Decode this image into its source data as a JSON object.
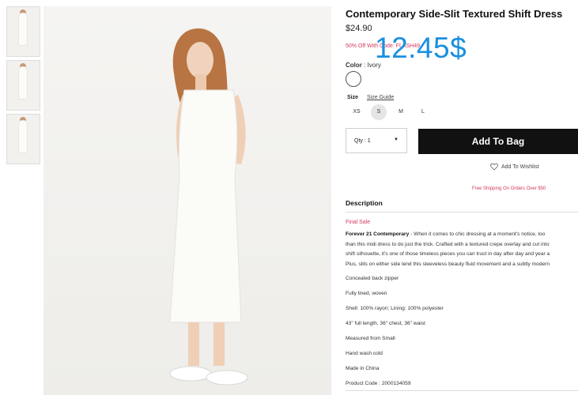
{
  "thumbnails": [
    {
      "alt": ""
    },
    {
      "alt": ""
    },
    {
      "alt": ""
    }
  ],
  "product": {
    "title": "Contemporary Side-Slit Textured Shift Dress",
    "price": "$24.90",
    "promo": "50% Off With Code: FLASH49",
    "overlay_price": "12.45$",
    "color_label": "Color",
    "color_value": ": Ivory",
    "swatch_color": "#ffffff",
    "size_label": "Size",
    "size_guide": "Size Guide",
    "sizes": [
      "XS",
      "S",
      "M",
      "L"
    ],
    "selected_size": "S",
    "qty_value": "Qty : 1",
    "add_to_bag": "Add To Bag",
    "wishlist": "Add To Wishlist",
    "shipping": "Free Shipping On Orders Over $50"
  },
  "description": {
    "heading": "Description",
    "final_sale": "Final Sale",
    "brand": "Forever 21 Contemporary",
    "lines": [
      " - When it comes to chic dressing at a moment's notice, loo",
      "than this midi dress to do just the trick. Crafted with a textured crepe overlay and cut into",
      "shift silhouette, it's one of those timeless pieces you can trust in day after day and year a",
      "Plus, slits on either side lend this sleeveless beauty fluid movement and a subtly modern"
    ],
    "specs": [
      "Concealed back zipper",
      "Fully lined, woven",
      "Shell: 100% rayon; Lining: 100% polyester",
      "43\" full length, 36\" chest, 36\" waist",
      "Measured from Small",
      "Hand wash cold",
      "Made in China",
      "Product Code : 2000134059"
    ]
  },
  "colors": {
    "accent": "#d23a5d",
    "overlay": "#1a8fe0",
    "button": "#111111"
  }
}
